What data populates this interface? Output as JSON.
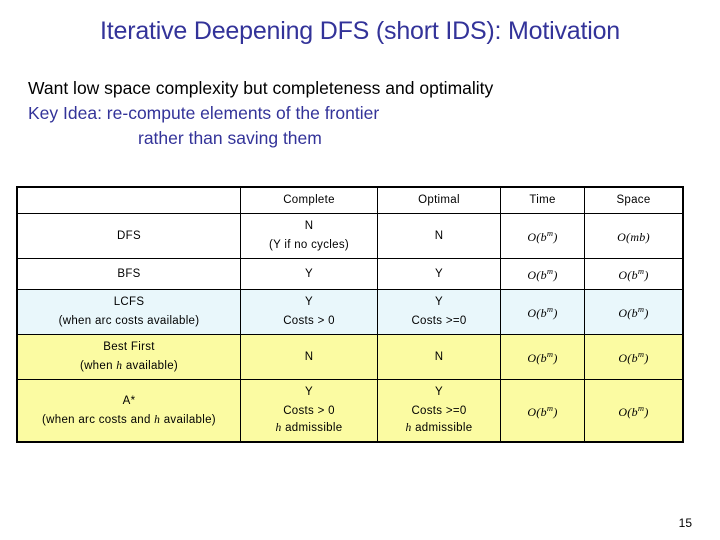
{
  "slide": {
    "title": "Iterative Deepening DFS (short IDS): Motivation",
    "page_number": "15",
    "title_color": "#333399",
    "accent_color": "#333399"
  },
  "body_lines": [
    {
      "text": "Want low space complexity but completeness and optimality",
      "color": "black",
      "indent": false
    },
    {
      "text": "Key Idea: re-compute elements of the frontier",
      "color": "navy",
      "indent": false
    },
    {
      "text": "rather than saving them",
      "color": "navy",
      "indent": true
    }
  ],
  "table": {
    "headers": [
      "",
      "Complete",
      "Optimal",
      "Time",
      "Space"
    ],
    "row_colors": {
      "white": "#ffffff",
      "cyan": "#e9f7fb",
      "yellow": "#fbfba2"
    },
    "rows": [
      {
        "style": "white",
        "name": "DFS",
        "name_sub": "",
        "complete": "N",
        "complete_sub": "(Y if no cycles)",
        "optimal": "N",
        "optimal_sub": "",
        "time": "O(b",
        "time_sup": "m",
        "time_end": ")",
        "space": "O(mb",
        "space_sup": "",
        "space_end": ")"
      },
      {
        "style": "white",
        "name": "BFS",
        "name_sub": "",
        "complete": "Y",
        "complete_sub": "",
        "optimal": "Y",
        "optimal_sub": "",
        "time": "O(b",
        "time_sup": "m",
        "time_end": ")",
        "space": "O(b",
        "space_sup": "m",
        "space_end": ")"
      },
      {
        "style": "cyan",
        "name": "LCFS",
        "name_sub": "(when arc costs available)",
        "complete": "Y",
        "complete_sub": "Costs > 0",
        "optimal": "Y",
        "optimal_sub": "Costs >=0",
        "time": "O(b",
        "time_sup": "m",
        "time_end": ")",
        "space": "O(b",
        "space_sup": "m",
        "space_end": ")"
      },
      {
        "style": "yellow",
        "name": "Best First",
        "name_sub": "(when h available)",
        "complete": "N",
        "complete_sub": "",
        "optimal": "N",
        "optimal_sub": "",
        "time": "O(b",
        "time_sup": "m",
        "time_end": ")",
        "space": "O(b",
        "space_sup": "m",
        "space_end": ")"
      },
      {
        "style": "yellow",
        "name": "A*",
        "name_sub": "(when arc costs and h available)",
        "complete": "Y",
        "complete_sub": "Costs > 0",
        "complete_sub2": "h admissible",
        "optimal": "Y",
        "optimal_sub": "Costs >=0",
        "optimal_sub2": "h admissible",
        "time": "O(b",
        "time_sup": "m",
        "time_end": ")",
        "space": "O(b",
        "space_sup": "m",
        "space_end": ")"
      }
    ]
  }
}
